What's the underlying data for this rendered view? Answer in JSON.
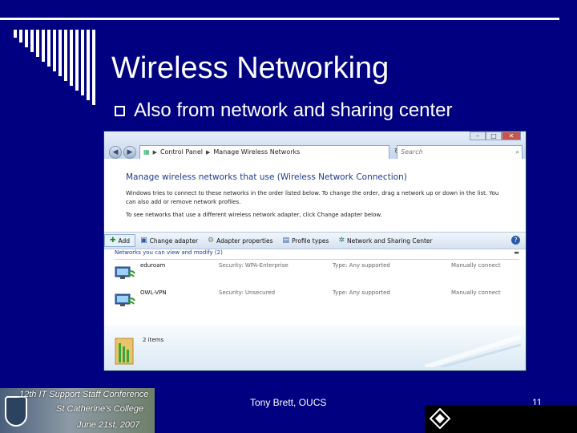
{
  "slide": {
    "title": "Wireless Networking",
    "bullet": "Also from network and sharing center",
    "footer": "Tony Brett, OUCS",
    "page_number": "11"
  },
  "banner": {
    "line1": "12th IT Support Staff Conference",
    "line2": "St Catherine's College",
    "line3": "June 21st, 2007"
  },
  "window": {
    "breadcrumb": [
      "Control Panel",
      "Manage Wireless Networks"
    ],
    "search_placeholder": "Search",
    "heading": "Manage wireless networks that use (Wireless Network Connection)",
    "description": "Windows tries to connect to these networks in the order listed below. To change the order, drag a network up or down in the list. You can also add or remove network profiles.",
    "description2": "To see networks that use a different wireless network adapter, click Change adapter below.",
    "toolbar": [
      "Add",
      "Change adapter",
      "Adapter properties",
      "Profile types",
      "Network and Sharing Center"
    ],
    "list_header": "Networks you can view and modify (2)",
    "networks": [
      {
        "name": "eduroam",
        "security": "Security: WPA-Enterprise",
        "type": "Type: Any supported",
        "mode": "Manually connect"
      },
      {
        "name": "OWL-VPN",
        "security": "Security: Unsecured",
        "type": "Type: Any supported",
        "mode": "Manually connect"
      }
    ],
    "items_count": "2 items"
  },
  "colors": {
    "background": "#000080",
    "heading_blue": "#1e3b8c"
  }
}
